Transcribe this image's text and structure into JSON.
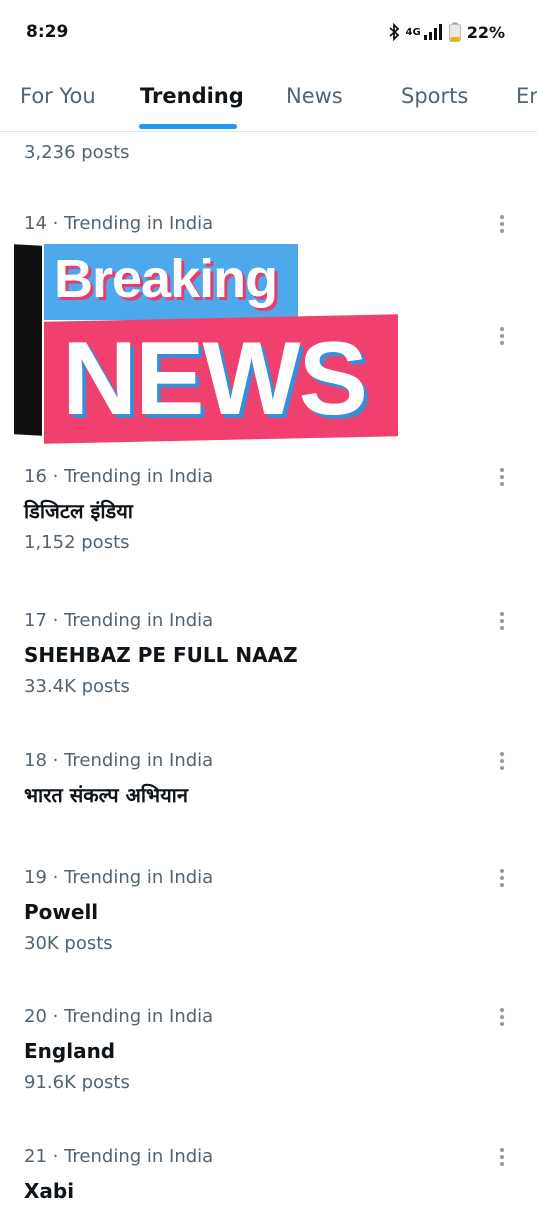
{
  "status": {
    "time": "8:29",
    "network": "4G",
    "battery": "22%"
  },
  "tabs": [
    {
      "label": "For You"
    },
    {
      "label": "Trending"
    },
    {
      "label": "News"
    },
    {
      "label": "Sports"
    },
    {
      "label": "Er"
    }
  ],
  "top_posts": "3,236 posts",
  "banner": {
    "line1": "Breaking",
    "line2": "NEWS"
  },
  "trends": [
    {
      "context": "14 · Trending in India",
      "title": "",
      "posts": ""
    },
    {
      "context": "16 · Trending in India",
      "title": "डिजिटल इंडिया",
      "posts": "1,152 posts"
    },
    {
      "context": "17 · Trending in India",
      "title": "SHEHBAZ PE FULL NAAZ",
      "posts": "33.4K posts"
    },
    {
      "context": "18 · Trending in India",
      "title": "भारत संकल्प अभियान",
      "posts": ""
    },
    {
      "context": "19 · Trending in India",
      "title": "Powell",
      "posts": "30K posts"
    },
    {
      "context": "20 · Trending in India",
      "title": "England",
      "posts": "91.6K posts"
    },
    {
      "context": "21 · Trending in India",
      "title": "Xabi",
      "posts": ""
    }
  ]
}
